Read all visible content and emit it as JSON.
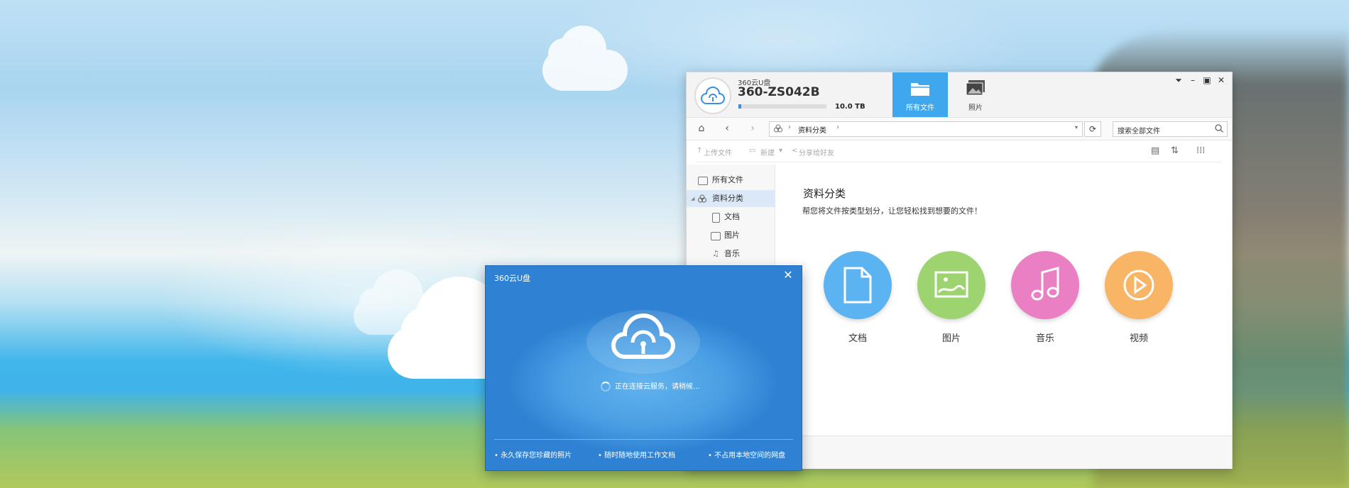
{
  "background": {
    "accent": "#3fa7ee",
    "dialog_blue": "#3d8fde"
  },
  "main_window": {
    "app_name": "360云U盘",
    "device_name": "360-ZS042B",
    "capacity": "10.0 TB",
    "capacity_used_fraction": 0.03,
    "tabs": [
      {
        "label": "所有文件",
        "icon": "folder-icon",
        "active": true
      },
      {
        "label": "照片",
        "icon": "photos-icon",
        "active": false
      }
    ],
    "window_controls": [
      "dropdown-icon",
      "minimize-icon",
      "maximize-icon",
      "close-icon"
    ],
    "address": {
      "path": "资料分类",
      "separator": "›"
    },
    "search": {
      "placeholder": "搜索全部文件"
    },
    "toolbar": {
      "upload": "上传文件",
      "new": "新建",
      "share": "分享给好友"
    },
    "sidebar": {
      "items": [
        {
          "label": "所有文件",
          "icon": "folder-icon"
        },
        {
          "label": "资料分类",
          "icon": "category-icon",
          "active": true
        },
        {
          "label": "文档",
          "icon": "document-icon"
        },
        {
          "label": "图片",
          "icon": "image-icon"
        },
        {
          "label": "音乐",
          "icon": "music-icon"
        }
      ]
    },
    "content": {
      "title": "资料分类",
      "subtitle": "帮您将文件按类型划分，让您轻松找到想要的文件！",
      "categories": [
        {
          "label": "文档",
          "icon": "document-icon",
          "color": "#5bb3f1"
        },
        {
          "label": "图片",
          "icon": "image-icon",
          "color": "#9ed470"
        },
        {
          "label": "音乐",
          "icon": "music-icon",
          "color": "#ea7fc3"
        },
        {
          "label": "视频",
          "icon": "video-icon",
          "color": "#f8b565"
        }
      ]
    }
  },
  "dialog": {
    "title": "360云U盘",
    "status": "正在连接云服务，请稍候...",
    "features": [
      "永久保存您珍藏的照片",
      "随时随地使用工作文档",
      "不占用本地空间的网盘"
    ]
  }
}
